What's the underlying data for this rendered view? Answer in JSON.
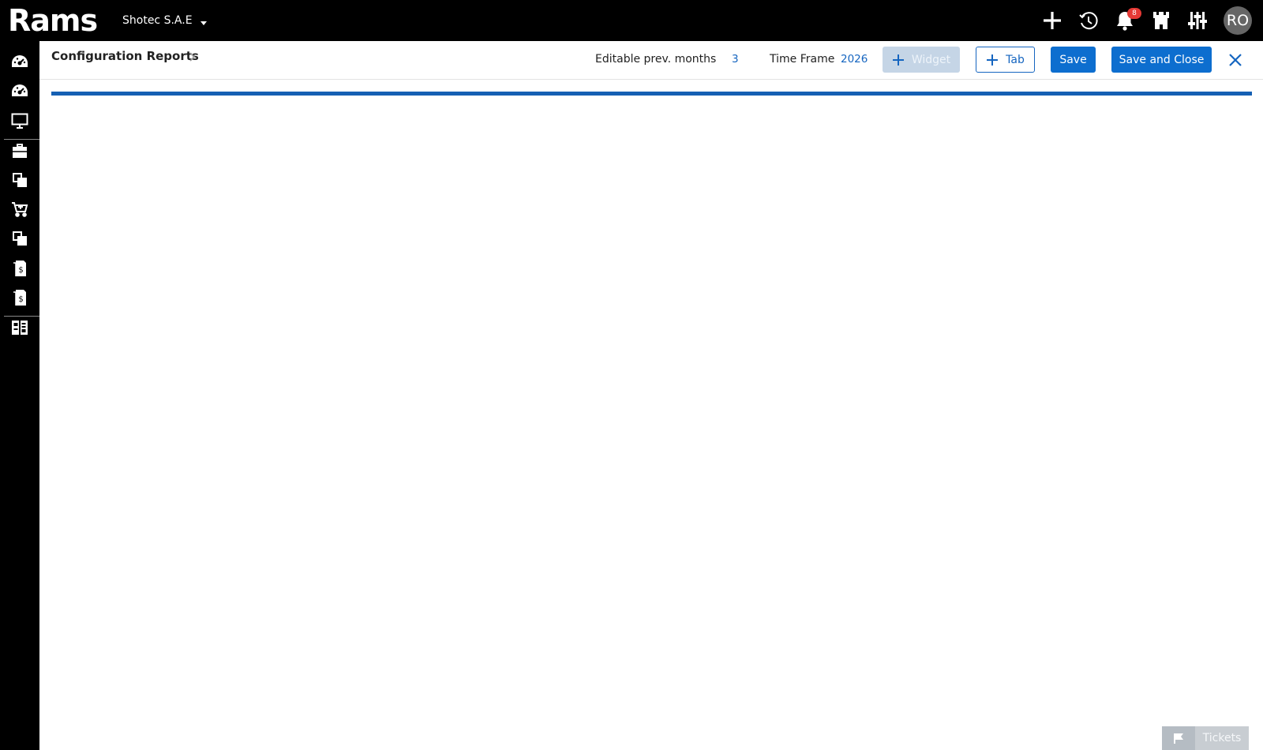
{
  "app": {
    "logo_text": "Rams",
    "company_name": "Shotec S.A.E",
    "notifications_count": "8",
    "user_initials": "RO"
  },
  "top_icons": [
    "plus-icon",
    "history-clock-icon",
    "bell-icon",
    "castle-icon",
    "sliders-icon"
  ],
  "sidebar": {
    "items": [
      {
        "icon": "dashboard-gauge-icon"
      },
      {
        "icon": "dashboard-gauge-icon"
      },
      {
        "icon": "monitor-icon",
        "active": true
      },
      {
        "icon": "briefcase-icon"
      },
      {
        "icon": "documents-icon"
      },
      {
        "icon": "cart-icon"
      },
      {
        "icon": "documents-icon"
      },
      {
        "icon": "invoice-dollar-icon"
      },
      {
        "icon": "invoice-dollar-icon"
      },
      {
        "icon": "report-grid-icon"
      }
    ]
  },
  "header": {
    "title": "Configuration Reports",
    "editable_label": "Editable prev. months",
    "editable_value": "3",
    "timeframe_label": "Time Frame",
    "timeframe_value": "2026",
    "widget_label": "Widget",
    "tab_label": "Tab",
    "save_label": "Save",
    "save_close_label": "Save and Close"
  },
  "footer": {
    "tickets_label": "Tickets"
  },
  "colors": {
    "primary": "#0d6ecf",
    "progress": "#1560b3",
    "badge": "#e53935",
    "disabled": "#c5d5e6"
  }
}
